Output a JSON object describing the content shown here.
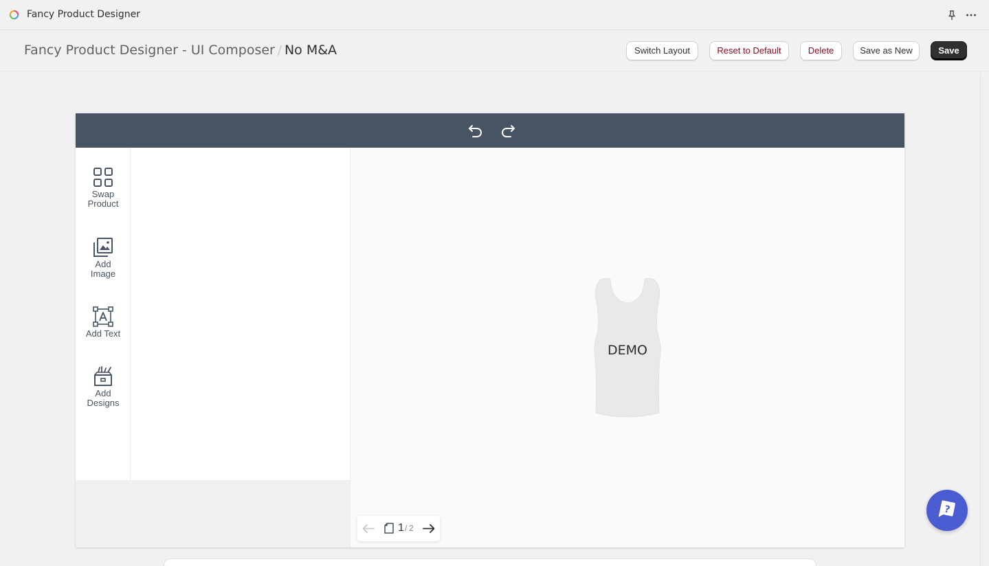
{
  "app": {
    "title": "Fancy Product Designer"
  },
  "header": {
    "breadcrumb_parent": "Fancy Product Designer - UI Composer",
    "breadcrumb_separator": "/",
    "title": "No M&A"
  },
  "actions": {
    "switch_layout": "Switch Layout",
    "reset_default": "Reset to Default",
    "delete": "Delete",
    "save_as_new": "Save as New",
    "save": "Save"
  },
  "designer": {
    "topbar_color": "#475463",
    "nav": [
      {
        "label_line1": "Swap",
        "label_line2": "Product",
        "icon": "grid-icon"
      },
      {
        "label_line1": "Add",
        "label_line2": "Image",
        "icon": "image-icon"
      },
      {
        "label_line1": "Add Text",
        "label_line2": "",
        "icon": "text-icon"
      },
      {
        "label_line1": "Add",
        "label_line2": "Designs",
        "icon": "designs-icon"
      }
    ],
    "product_text": "DEMO",
    "pager": {
      "current": "1",
      "separator": "/",
      "total": "2"
    }
  },
  "colors": {
    "primary_button": "#303030",
    "danger_text": "#8e0b21",
    "help_button": "#4b5bd0"
  }
}
